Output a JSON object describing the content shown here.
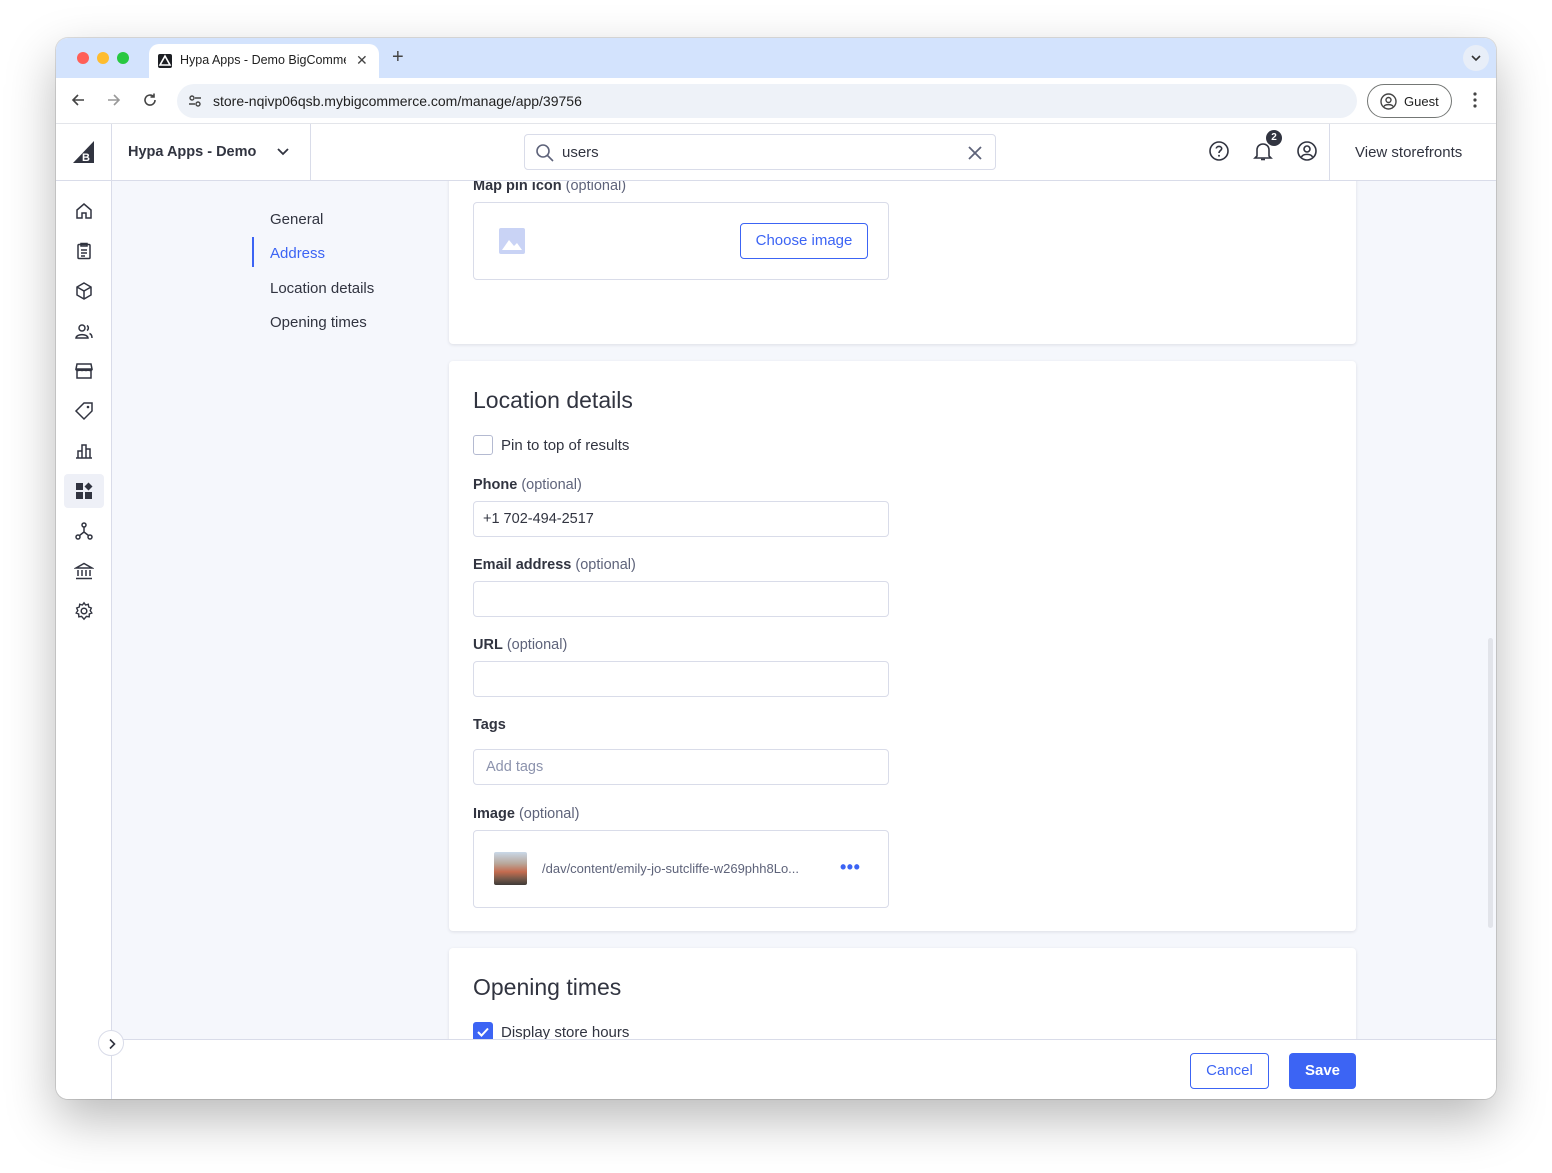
{
  "browser": {
    "tab_title": "Hypa Apps - Demo BigCommerce",
    "url": "store-nqivp06qsb.mybigcommerce.com/manage/app/39756",
    "profile_label": "Guest"
  },
  "header": {
    "store_name": "Hypa Apps - Demo",
    "search_value": "users",
    "notification_count": "2",
    "view_storefronts": "View storefronts"
  },
  "sidenav": {
    "items": [
      {
        "label": "General",
        "active": false
      },
      {
        "label": "Address",
        "active": true
      },
      {
        "label": "Location details",
        "active": false
      },
      {
        "label": "Opening times",
        "active": false
      }
    ]
  },
  "map_pin": {
    "label": "Map pin icon",
    "optional": "(optional)",
    "button": "Choose image"
  },
  "location_details": {
    "title": "Location details",
    "pin_label": "Pin to top of results",
    "pin_checked": false,
    "phone_label": "Phone",
    "phone_value": "+1 702-494-2517",
    "email_label": "Email address",
    "email_value": "",
    "url_label": "URL",
    "url_value": "",
    "tags_label": "Tags",
    "tags_placeholder": "Add tags",
    "image_label": "Image",
    "image_path": "/dav/content/emily-jo-sutcliffe-w269phh8Lo...",
    "optional": "(optional)"
  },
  "opening_times": {
    "title": "Opening times",
    "display_hours_label": "Display store hours",
    "display_hours_checked": true
  },
  "footer": {
    "cancel": "Cancel",
    "save": "Save"
  },
  "colors": {
    "accent": "#3c64f4",
    "text": "#313440",
    "background": "#f5f7fc"
  }
}
